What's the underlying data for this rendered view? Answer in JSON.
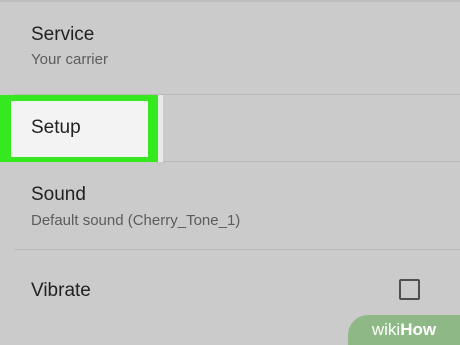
{
  "settings": {
    "service": {
      "title": "Service",
      "subtitle": "Your carrier"
    },
    "setup": {
      "title": "Setup",
      "highlight_color": "#35e81f"
    },
    "sound": {
      "title": "Sound",
      "subtitle": "Default sound (Cherry_Tone_1)"
    },
    "vibrate": {
      "title": "Vibrate",
      "checked": false
    }
  },
  "watermark": {
    "prefix": "wiki",
    "suffix": "How"
  }
}
